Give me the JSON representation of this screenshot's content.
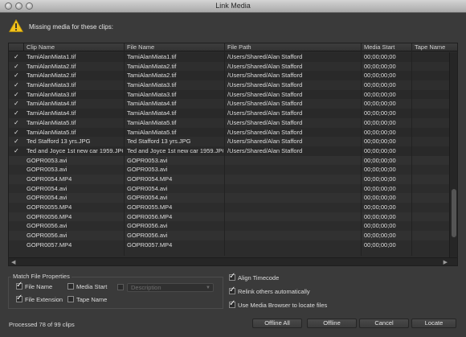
{
  "window": {
    "title": "Link Media"
  },
  "header": {
    "message": "Missing media for these clips:"
  },
  "table": {
    "columns": [
      "Clip Name",
      "File Name",
      "File Path",
      "Media Start",
      "Tape Name"
    ],
    "rows": [
      {
        "checked": true,
        "clip": "TamiAlanMiata1.tif",
        "file": "TamiAlanMiata1.tif",
        "path": "/Users/Shared/Alan Stafford",
        "start": "00;00;00;00",
        "tape": ""
      },
      {
        "checked": true,
        "clip": "TamiAlanMiata2.tif",
        "file": "TamiAlanMiata2.tif",
        "path": "/Users/Shared/Alan Stafford",
        "start": "00;00;00;00",
        "tape": ""
      },
      {
        "checked": true,
        "clip": "TamiAlanMiata2.tif",
        "file": "TamiAlanMiata2.tif",
        "path": "/Users/Shared/Alan Stafford",
        "start": "00;00;00;00",
        "tape": ""
      },
      {
        "checked": true,
        "clip": "TamiAlanMiata3.tif",
        "file": "TamiAlanMiata3.tif",
        "path": "/Users/Shared/Alan Stafford",
        "start": "00;00;00;00",
        "tape": ""
      },
      {
        "checked": true,
        "clip": "TamiAlanMiata3.tif",
        "file": "TamiAlanMiata3.tif",
        "path": "/Users/Shared/Alan Stafford",
        "start": "00;00;00;00",
        "tape": ""
      },
      {
        "checked": true,
        "clip": "TamiAlanMiata4.tif",
        "file": "TamiAlanMiata4.tif",
        "path": "/Users/Shared/Alan Stafford",
        "start": "00;00;00;00",
        "tape": ""
      },
      {
        "checked": true,
        "clip": "TamiAlanMiata4.tif",
        "file": "TamiAlanMiata4.tif",
        "path": "/Users/Shared/Alan Stafford",
        "start": "00;00;00;00",
        "tape": ""
      },
      {
        "checked": true,
        "clip": "TamiAlanMiata5.tif",
        "file": "TamiAlanMiata5.tif",
        "path": "/Users/Shared/Alan Stafford",
        "start": "00;00;00;00",
        "tape": ""
      },
      {
        "checked": true,
        "clip": "TamiAlanMiata5.tif",
        "file": "TamiAlanMiata5.tif",
        "path": "/Users/Shared/Alan Stafford",
        "start": "00;00;00;00",
        "tape": ""
      },
      {
        "checked": true,
        "clip": "Ted Stafford 13 yrs.JPG",
        "file": "Ted Stafford 13 yrs.JPG",
        "path": "/Users/Shared/Alan Stafford",
        "start": "00;00;00;00",
        "tape": ""
      },
      {
        "checked": true,
        "clip": "Ted and Joyce 1st new car 1959.JPG",
        "file": "Ted and Joyce 1st new car 1959.JPG",
        "path": "/Users/Shared/Alan Stafford",
        "start": "00;00;00;00",
        "tape": ""
      },
      {
        "checked": false,
        "clip": "GOPR0053.avi",
        "file": "GOPR0053.avi",
        "path": "",
        "start": "00;00;00;00",
        "tape": ""
      },
      {
        "checked": false,
        "clip": "GOPR0053.avi",
        "file": "GOPR0053.avi",
        "path": "",
        "start": "00;00;00;00",
        "tape": ""
      },
      {
        "checked": false,
        "clip": "GOPR0054.MP4",
        "file": "GOPR0054.MP4",
        "path": "",
        "start": "00;00;00;00",
        "tape": ""
      },
      {
        "checked": false,
        "clip": "GOPR0054.avi",
        "file": "GOPR0054.avi",
        "path": "",
        "start": "00;00;00;00",
        "tape": ""
      },
      {
        "checked": false,
        "clip": "GOPR0054.avi",
        "file": "GOPR0054.avi",
        "path": "",
        "start": "00;00;00;00",
        "tape": ""
      },
      {
        "checked": false,
        "clip": "GOPR0055.MP4",
        "file": "GOPR0055.MP4",
        "path": "",
        "start": "00;00;00;00",
        "tape": ""
      },
      {
        "checked": false,
        "clip": "GOPR0056.MP4",
        "file": "GOPR0056.MP4",
        "path": "",
        "start": "00;00;00;00",
        "tape": ""
      },
      {
        "checked": false,
        "clip": "GOPR0056.avi",
        "file": "GOPR0056.avi",
        "path": "",
        "start": "00;00;00;00",
        "tape": ""
      },
      {
        "checked": false,
        "clip": "GOPR0056.avi",
        "file": "GOPR0056.avi",
        "path": "",
        "start": "00;00;00;00",
        "tape": ""
      },
      {
        "checked": false,
        "clip": "GOPR0057.MP4",
        "file": "GOPR0057.MP4",
        "path": "",
        "start": "00;00;00;00",
        "tape": ""
      }
    ]
  },
  "match": {
    "legend": "Match File Properties",
    "file_name": {
      "label": "File Name",
      "checked": true
    },
    "media_start": {
      "label": "Media Start",
      "checked": false
    },
    "description": {
      "label": "Description",
      "checked": false,
      "enabled": false
    },
    "file_extension": {
      "label": "File Extension",
      "checked": true
    },
    "tape_name": {
      "label": "Tape Name",
      "checked": false
    }
  },
  "options": {
    "align_timecode": {
      "label": "Align Timecode",
      "checked": true
    },
    "relink_others": {
      "label": "Relink others automatically",
      "checked": true
    },
    "media_browser": {
      "label": "Use Media Browser to locate files",
      "checked": true
    }
  },
  "status": "Processed 78 of 99 clips",
  "buttons": {
    "offline_all": "Offline All",
    "offline": "Offline",
    "cancel": "Cancel",
    "locate": "Locate"
  },
  "colors": {
    "background": "#3a3a3a",
    "table_bg": "#2c2c2c",
    "warning": "#f2c21b"
  }
}
